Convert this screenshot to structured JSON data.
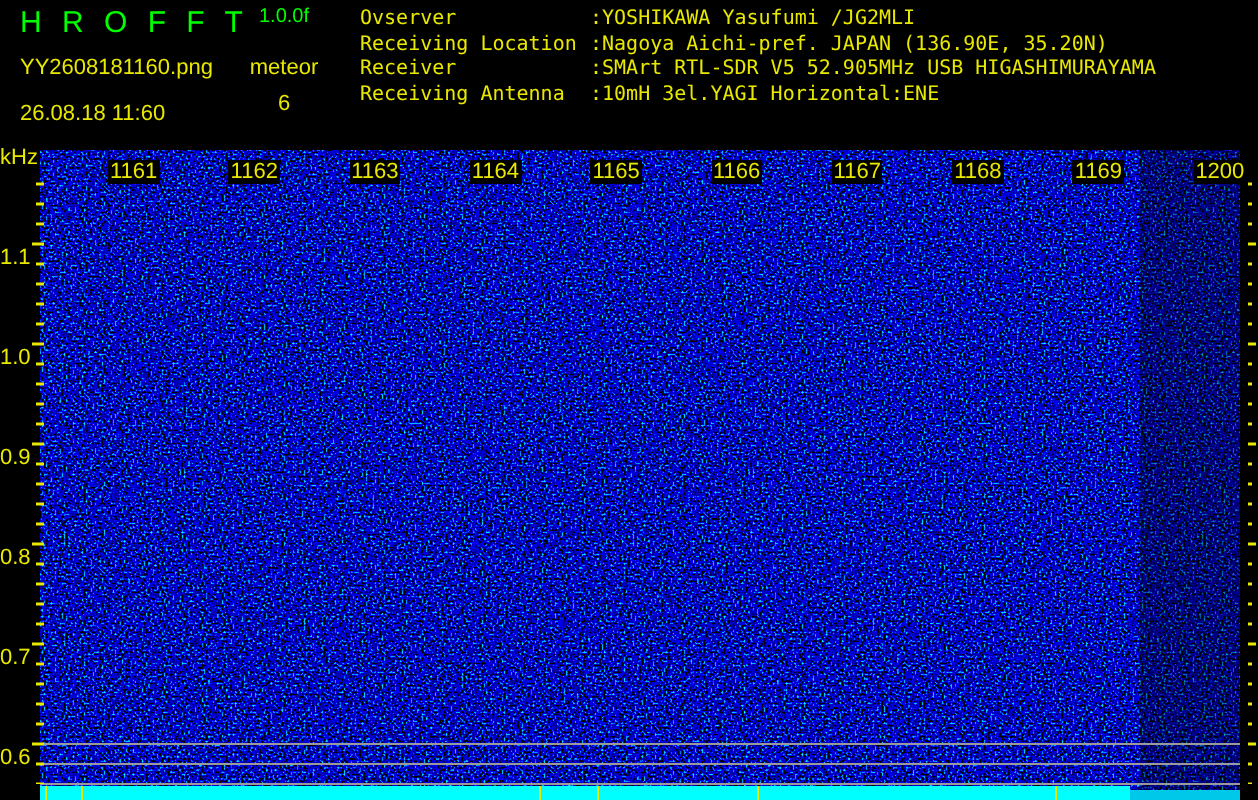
{
  "header": {
    "title": "H R O F F T",
    "version": "1.0.0f",
    "filename": "YY2608181160.png",
    "datetime": "26.08.18 11:60",
    "meteor_label": "meteor",
    "meteor_count": "6",
    "info": [
      {
        "label": "Ovserver",
        "value": ":YOSHIKAWA Yasufumi /JG2MLI"
      },
      {
        "label": "Receiving Location",
        "value": ":Nagoya Aichi-pref. JAPAN (136.90E, 35.20N)"
      },
      {
        "label": "Receiver",
        "value": ":SMArt RTL-SDR V5 52.905MHz USB HIGASHIMURAYAMA"
      },
      {
        "label": "Receiving Antenna",
        "value": ":10mH 3el.YAGI Horizontal:ENE"
      }
    ]
  },
  "spectrogram": {
    "unit": "kHz",
    "y_labels": [
      "1.1",
      "1.0",
      "0.9",
      "0.8",
      "0.7",
      "0.6"
    ],
    "time_labels": [
      "1161",
      "1162",
      "1163",
      "1164",
      "1165",
      "1166",
      "1167",
      "1168",
      "1169",
      "1200"
    ]
  }
}
